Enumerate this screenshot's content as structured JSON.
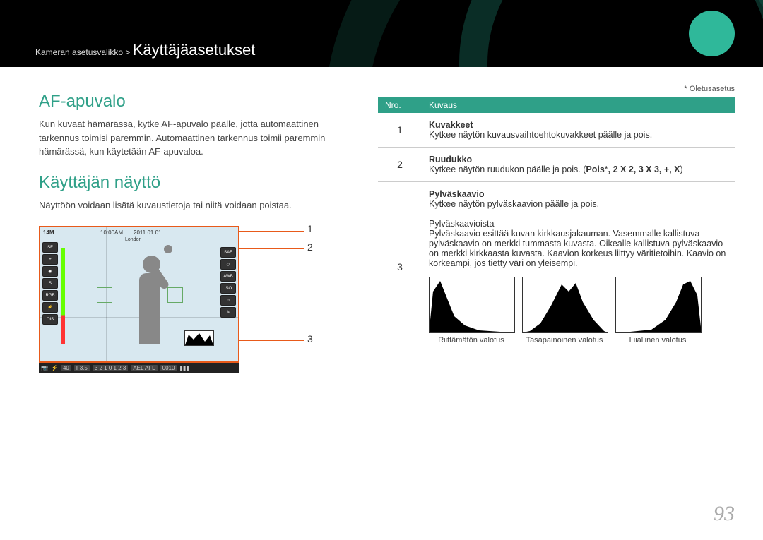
{
  "header": {
    "breadcrumb_prefix": "Kameran asetusvalikko > ",
    "breadcrumb_main": "Käyttäjäasetukset"
  },
  "left": {
    "section1_title": "AF-apuvalo",
    "section1_body": "Kun kuvaat hämärässä, kytke AF-apuvalo päälle, jotta automaattinen tarkennus toimisi paremmin. Automaattinen tarkennus toimii paremmin hämärässä, kun käytetään AF-apuvaloa.",
    "section2_title": "Käyttäjän näyttö",
    "section2_body": "Näyttöön voidaan lisätä kuvaustietoja tai niitä voidaan poistaa.",
    "callouts": {
      "c1": "1",
      "c2": "2",
      "c3": "3"
    },
    "screen": {
      "res": "14M",
      "time": "10:00AM",
      "date": "2011.01.01",
      "city": "London",
      "shutter": "40",
      "aperture": "F3.5",
      "ev_scale": "3 2 1 0 1 2 3",
      "ael": "AEL AFL",
      "shots": "0010"
    }
  },
  "right": {
    "default_note": "* Oletusasetus",
    "table": {
      "head_nro": "Nro.",
      "head_kuvaus": "Kuvaus",
      "rows": [
        {
          "num": "1",
          "title": "Kuvakkeet",
          "desc": "Kytkee näytön kuvausvaihtoehtokuvakkeet päälle ja pois."
        },
        {
          "num": "2",
          "title": "Ruudukko",
          "desc_pre": "Kytkee näytön ruudukon päälle ja pois. (",
          "desc_bold": "Pois",
          "desc_star": "*",
          "desc_opts": ", 2 X 2, 3 X 3, +, X",
          "desc_post": ")"
        },
        {
          "num": "3",
          "title": "Pylväskaavio",
          "desc1": "Kytkee näytön pylväskaavion päälle ja pois.",
          "subtitle": "Pylväskaavioista",
          "desc2": "Pylväskaavio esittää kuvan kirkkausjakauman. Vasemmalle kallistuva pylväskaavio on merkki tummasta kuvasta. Oikealle kallistuva pylväskaavio on merkki kirkkaasta kuvasta. Kaavion korkeus liittyy väritietoihin. Kaavio on korkeampi, jos tietty väri on yleisempi."
        }
      ]
    },
    "histograms": {
      "under": "Riittämätön valotus",
      "balanced": "Tasapainoinen valotus",
      "over": "Liiallinen valotus"
    }
  },
  "page_number": "93"
}
